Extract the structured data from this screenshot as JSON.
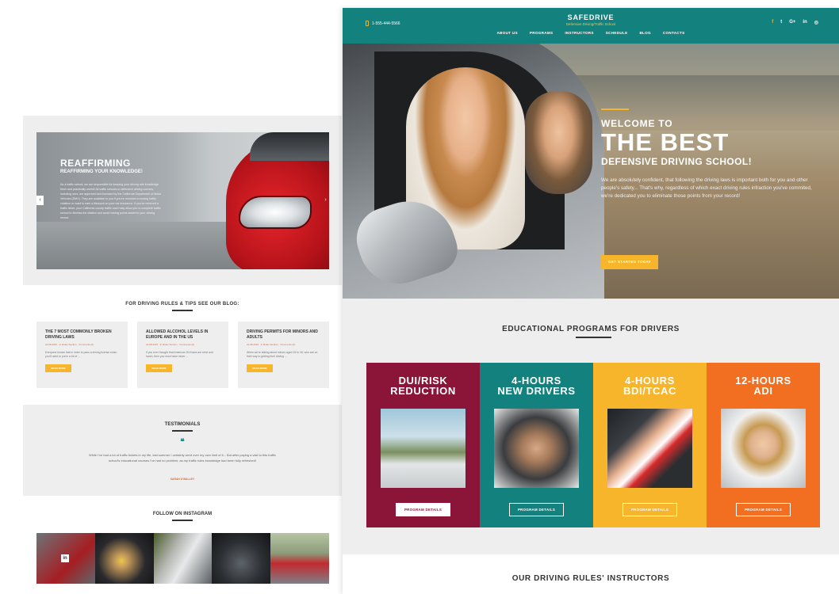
{
  "left_page": {
    "slider": {
      "title": "REAFFIRMING",
      "subtitle": "REAFFIRMING YOUR KNOWLEDGE!",
      "body": "As a traffic school, we are responsible for keeping your driving rule knowledge fresh and practically useful! All traffic schools or defensive driving courses, including ours, are approved and licensed by the California Department of Motor Vehicles (DMV). They are available to you if you've received a moving traffic violation or want to earn a discount on your car insurance. If you've received a traffic ticket, your California county traffic court may allow you to complete traffic school to dismiss the citation and avoid having points added to your driving record.",
      "prev": "‹",
      "next": "›"
    },
    "blog": {
      "title": "FOR DRIVING RULES & TIPS SEE OUR BLOG:",
      "posts": [
        {
          "title": "THE 7 MOST COMMONLY BROKEN DRIVING LAWS",
          "meta": "22.08.2015   ·   In Rules Section   ·   Comments (0)",
          "excerpt": "Everyone knows that in order to pass a driving license exam you'll need to put in a lot of ...",
          "button": "READ MORE"
        },
        {
          "title": "ALLOWED ALCOHOL LEVELS IN EUROPE AND IN THE US",
          "meta": "22.08.2015   ·   In Rules Section   ·   Comments (0)",
          "excerpt": "If you ever thought that American DUI laws are strict and harsh, then you must have never ...",
          "button": "READ MORE"
        },
        {
          "title": "DRIVING PERMITS FOR MINORS AND ADULTS",
          "meta": "22.08.2015   ·   In Rules Section   ·   Comments (0)",
          "excerpt": "When we're talking about minors aged 15 to 18, who are on their way to getting their driving ...",
          "button": "READ MORE"
        }
      ]
    },
    "testimonials": {
      "title": "TESTIMONIALS",
      "quote_mark": "❝",
      "text": "While I've had a lot of traffic tickets in my life, last summer I certainly went over my own limit of it... But after paying a visit to this traffic school's educational courses I've had no problem, as my traffic rules knowledge had been fully refreshed!",
      "author": "SARAH D'WALLEY"
    },
    "instagram": {
      "title": "FOLLOW ON INSTAGRAM",
      "badge": "in"
    }
  },
  "header": {
    "phone": "1-555-444-5566",
    "logo_name": "SAFEDRIVE",
    "logo_tagline": "Defensive Driving/Traffic School",
    "nav": [
      "ABOUT US",
      "PROGRAMS",
      "INSTRUCTORS",
      "SCHEDULE",
      "BLOG",
      "CONTACTS"
    ],
    "social": [
      "f",
      "t",
      "G+",
      "in",
      "◎"
    ]
  },
  "hero": {
    "welcome": "WELCOME TO",
    "big": "THE BEST",
    "subtitle": "DEFENSIVE DRIVING SCHOOL!",
    "body": "We are absolutely confident, that following the driving laws is important both for you and other people's safety... That's why, regardless of which exact driving rules infraction you've commited, we're dedicated you to eliminate those points from your record!",
    "button": "GET STARTED TODAY"
  },
  "programs": {
    "title": "EDUCATIONAL PROGRAMS FOR DRIVERS",
    "cards": [
      {
        "name": "DUI/RISK\nREDUCTION",
        "button": "PROGRAM DETAILS"
      },
      {
        "name": "4-HOURS\nNEW DRIVERS",
        "button": "PROGRAM DETAILS"
      },
      {
        "name": "4-HOURS\nBDI/TCAC",
        "button": "PROGRAM DETAILS"
      },
      {
        "name": "12-HOURS\nADI",
        "button": "PROGRAM DETAILS"
      }
    ],
    "colors": {
      "dui": "#8b1538",
      "new_drivers": "#13817e",
      "bdi": "#f7b52c",
      "adi": "#f26f21"
    }
  },
  "instructors": {
    "title": "OUR DRIVING RULES' INSTRUCTORS"
  },
  "colors": {
    "teal": "#13817e",
    "accent": "#f7b52c"
  }
}
